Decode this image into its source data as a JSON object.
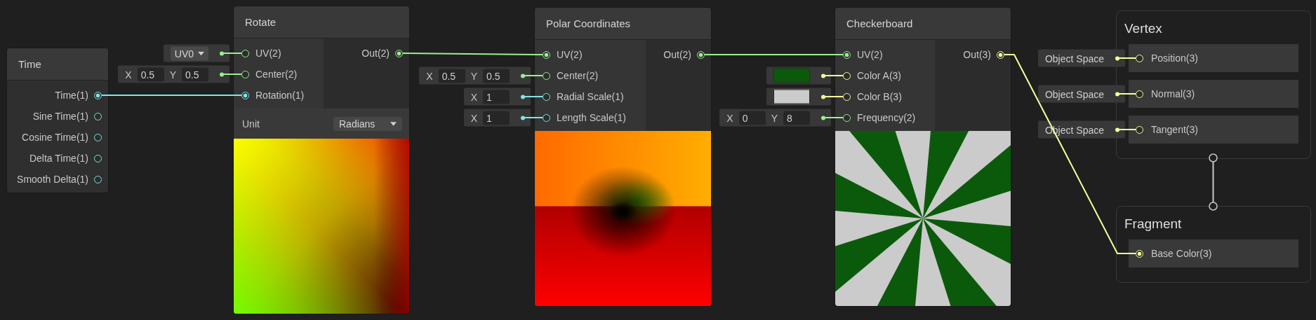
{
  "nodes": [
    {
      "title": "Time",
      "outputs": [
        {
          "label": "Time(1)",
          "kind": "float",
          "connected": true
        },
        {
          "label": "Sine Time(1)",
          "kind": "float",
          "connected": false
        },
        {
          "label": "Cosine Time(1)",
          "kind": "float",
          "connected": false
        },
        {
          "label": "Delta Time(1)",
          "kind": "float",
          "connected": false
        },
        {
          "label": "Smooth Delta(1)",
          "kind": "float",
          "connected": false
        }
      ]
    },
    {
      "title": "Rotate",
      "inputs": [
        {
          "label": "UV(2)",
          "kind": "vec2",
          "connected": false,
          "default": {
            "kind": "dropdown",
            "value": "UV0"
          }
        },
        {
          "label": "Center(2)",
          "kind": "vec2",
          "connected": false,
          "default": {
            "kind": "vector",
            "fields": [
              {
                "axis": "X",
                "value": "0.5"
              },
              {
                "axis": "Y",
                "value": "0.5"
              }
            ]
          }
        },
        {
          "label": "Rotation(1)",
          "kind": "float",
          "connected": true
        }
      ],
      "outputs": [
        {
          "label": "Out(2)",
          "kind": "vec2",
          "connected": true
        }
      ],
      "settings": [
        {
          "label": "Unit",
          "value": "Radians"
        }
      ],
      "preview": {
        "kind": "picture"
      }
    },
    {
      "title": "Polar Coordinates",
      "inputs": [
        {
          "label": "UV(2)",
          "kind": "vec2",
          "connected": true
        },
        {
          "label": "Center(2)",
          "kind": "vec2",
          "connected": false,
          "default": {
            "kind": "vector",
            "fields": [
              {
                "axis": "X",
                "value": "0.5"
              },
              {
                "axis": "Y",
                "value": "0.5"
              }
            ]
          }
        },
        {
          "label": "Radial Scale(1)",
          "kind": "float",
          "connected": false,
          "default": {
            "kind": "vector",
            "fields": [
              {
                "axis": "X",
                "value": "1"
              }
            ]
          }
        },
        {
          "label": "Length Scale(1)",
          "kind": "float",
          "connected": false,
          "default": {
            "kind": "vector",
            "fields": [
              {
                "axis": "X",
                "value": "1"
              }
            ]
          }
        }
      ],
      "outputs": [
        {
          "label": "Out(2)",
          "kind": "vec2",
          "connected": true
        }
      ],
      "preview": {
        "kind": "picture"
      }
    },
    {
      "title": "Checkerboard",
      "inputs": [
        {
          "label": "UV(2)",
          "kind": "vec2",
          "connected": true
        },
        {
          "label": "Color A(3)",
          "kind": "vec3",
          "connected": false,
          "default": {
            "kind": "color",
            "color": "#0b5a0b"
          }
        },
        {
          "label": "Color B(3)",
          "kind": "vec3",
          "connected": false,
          "default": {
            "kind": "color",
            "color": "#cbcbcb"
          }
        },
        {
          "label": "Frequency(2)",
          "kind": "vec2",
          "connected": false,
          "default": {
            "kind": "vector",
            "fields": [
              {
                "axis": "X",
                "value": "0"
              },
              {
                "axis": "Y",
                "value": "8"
              }
            ]
          }
        }
      ],
      "outputs": [
        {
          "label": "Out(3)",
          "kind": "vec3",
          "connected": true
        }
      ],
      "preview": {
        "kind": "picture"
      }
    }
  ],
  "stacks": [
    {
      "title": "Vertex",
      "blocks": [
        {
          "label": "Position(3)",
          "kind": "vec3",
          "connected": false,
          "default": {
            "kind": "space",
            "value": "Object Space"
          }
        },
        {
          "label": "Normal(3)",
          "kind": "vec3",
          "connected": false,
          "default": {
            "kind": "space",
            "value": "Object Space"
          }
        },
        {
          "label": "Tangent(3)",
          "kind": "vec3",
          "connected": false,
          "default": {
            "kind": "space",
            "value": "Object Space"
          }
        }
      ]
    },
    {
      "title": "Fragment",
      "blocks": [
        {
          "label": "Base Color(3)",
          "kind": "vec3",
          "connected": true
        }
      ]
    }
  ]
}
